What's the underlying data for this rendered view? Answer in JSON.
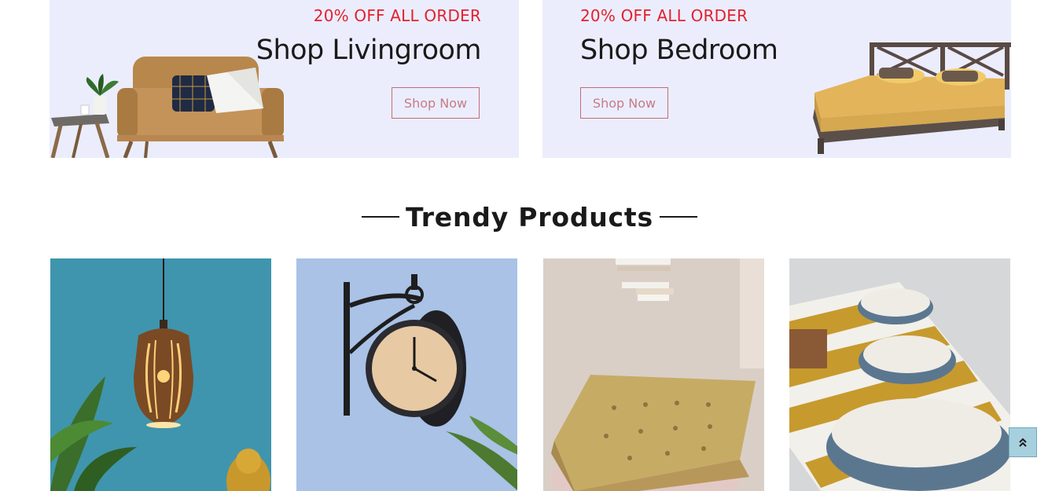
{
  "banners": {
    "living": {
      "promo": "20% OFF ALL ORDER",
      "title": "Shop Livingroom",
      "button": "Shop Now"
    },
    "bedroom": {
      "promo": "20% OFF ALL ORDER",
      "title": "Shop Bedroom",
      "button": "Shop Now"
    }
  },
  "section": {
    "title": "Trendy Products"
  },
  "products": [
    {
      "image": "pendant-lamp-image"
    },
    {
      "image": "wall-clock-image"
    },
    {
      "image": "floor-cushion-image"
    },
    {
      "image": "ceramic-bowls-image"
    }
  ],
  "colors": {
    "banner_bg": "#ebedfd",
    "promo_red": "#e5202e",
    "button_border": "#c56b79",
    "back_to_top": "#a7d0de"
  },
  "icons": {
    "back_to_top": "double-chevron-up-icon"
  }
}
